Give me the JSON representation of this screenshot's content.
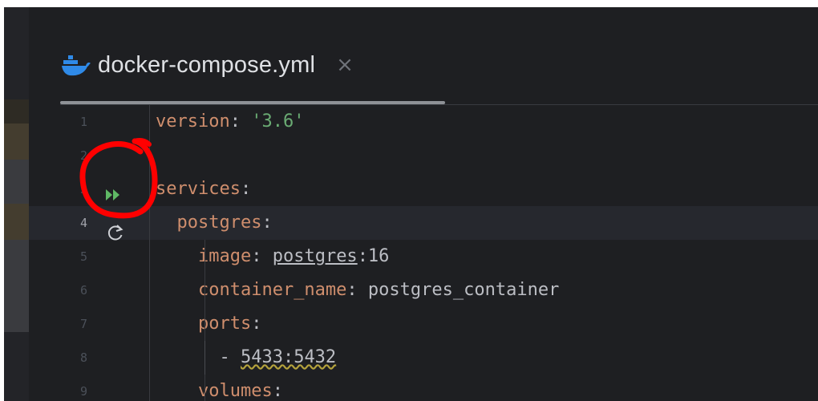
{
  "tab": {
    "title": "docker-compose.yml",
    "close_glyph": "×",
    "icon": "docker-icon"
  },
  "editor": {
    "lines": [
      {
        "number": "1",
        "text": "version: '3.6'"
      },
      {
        "number": "2",
        "text": ""
      },
      {
        "number": "3",
        "text": "services:"
      },
      {
        "number": "4",
        "text": "  postgres:"
      },
      {
        "number": "5",
        "text": "    image: postgres:16"
      },
      {
        "number": "6",
        "text": "    container_name: postgres_container"
      },
      {
        "number": "7",
        "text": "    ports:"
      },
      {
        "number": "8",
        "text": "      - 5433:5432"
      },
      {
        "number": "9",
        "text": "    volumes:"
      }
    ],
    "current_line": "4",
    "gutter_icons": [
      "run-services-icon",
      "reload-icon"
    ]
  },
  "annotation": {
    "color": "#ff0000",
    "shape": "red-hand-drawn-circle"
  },
  "colors": {
    "background": "#1e1f22",
    "keyword": "#cf8e6d",
    "string": "#6aab73",
    "text": "#bcbec4",
    "run_icon": "#5fb865",
    "docker_blue": "#2f8ae8"
  }
}
